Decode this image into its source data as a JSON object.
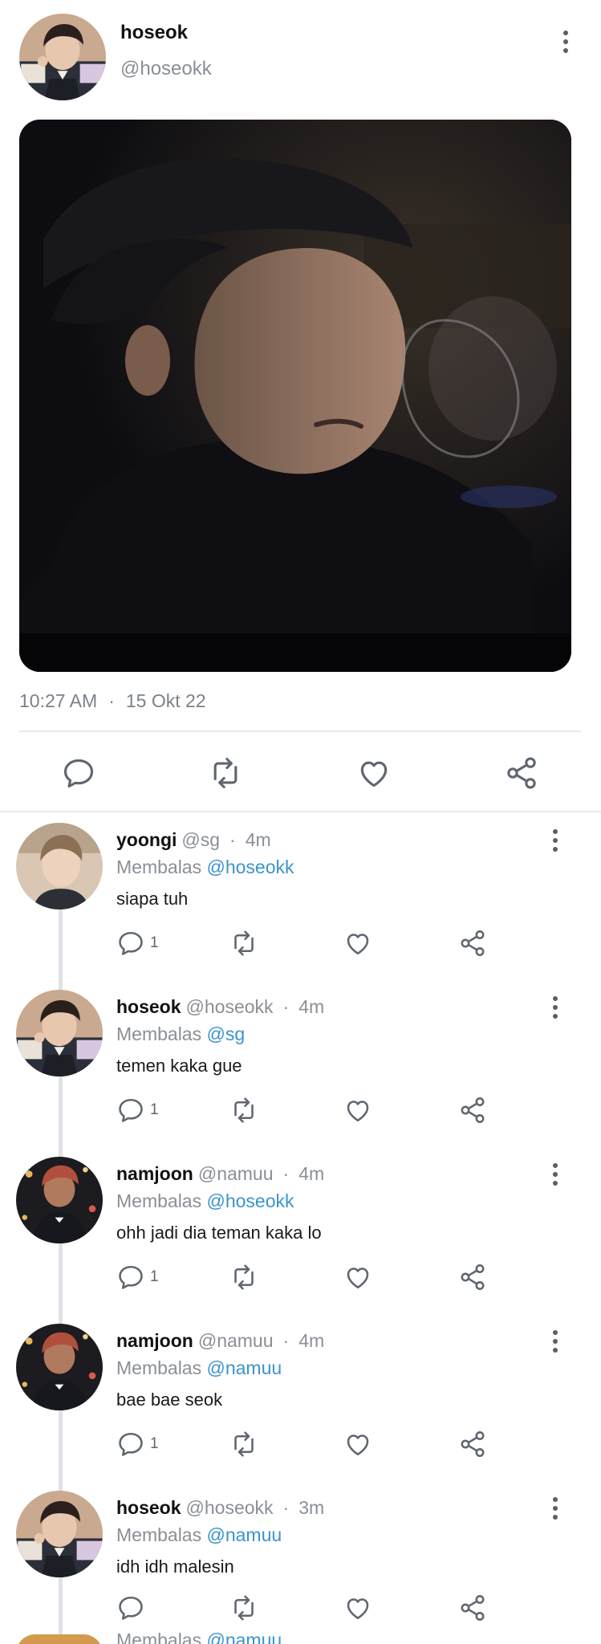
{
  "post": {
    "author_name": "hoseok",
    "author_handle": "@hoseokk",
    "time": "10:27 AM",
    "separator": "·",
    "date": "15 Okt 22"
  },
  "icons": {
    "reply": "speech-bubble-icon",
    "retweet": "retweet-icon",
    "like": "heart-icon",
    "share": "share-icon",
    "more": "kebab-menu-icon"
  },
  "colors": {
    "mention": "#3b94cc",
    "muted": "#8a8f96",
    "icon": "#5f6670",
    "thread_line": "#dfe2e6"
  },
  "replies": [
    {
      "name": "yoongi",
      "handle": "@sg",
      "sep": "·",
      "time": "4m",
      "replying_label": "Membalas",
      "replying_to": "@hoseokk",
      "text": "siapa tuh",
      "reply_count": "1"
    },
    {
      "name": "hoseok",
      "handle": "@hoseokk",
      "sep": "·",
      "time": "4m",
      "replying_label": "Membalas",
      "replying_to": "@sg",
      "text": "temen kaka gue",
      "reply_count": "1"
    },
    {
      "name": "namjoon",
      "handle": "@namuu",
      "sep": "·",
      "time": "4m",
      "replying_label": "Membalas",
      "replying_to": "@hoseokk",
      "text": "ohh jadi dia teman kaka lo",
      "reply_count": "1"
    },
    {
      "name": "namjoon",
      "handle": "@namuu",
      "sep": "·",
      "time": "4m",
      "replying_label": "Membalas",
      "replying_to": "@namuu",
      "text": "bae bae seok",
      "reply_count": "1"
    },
    {
      "name": "hoseok",
      "handle": "@hoseokk",
      "sep": "·",
      "time": "3m",
      "replying_label": "Membalas",
      "replying_to": "@namuu",
      "text": "idh idh malesin",
      "reply_count": ""
    }
  ],
  "next_reply_partial": {
    "replying_label": "Membalas",
    "replying_to": "@namuu"
  }
}
